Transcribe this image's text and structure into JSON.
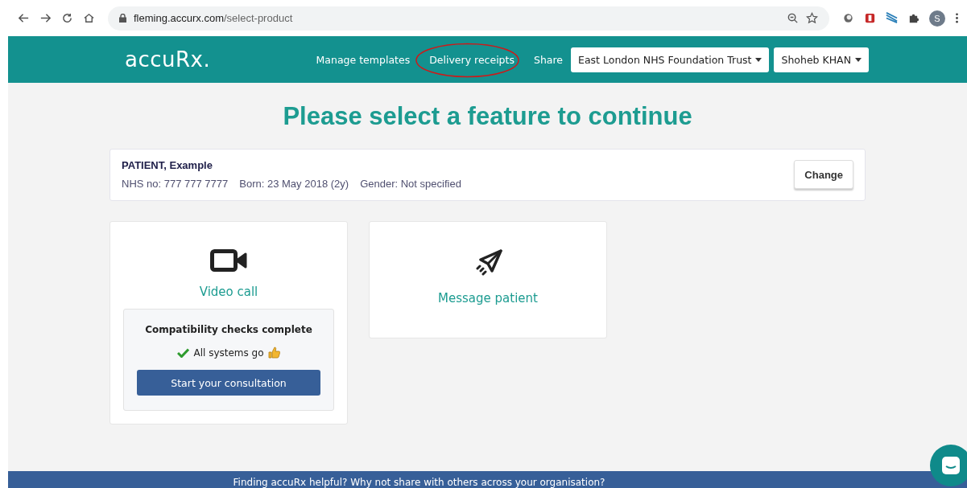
{
  "browser": {
    "url_host": "fleming.accurx.com",
    "url_path": "/select-product",
    "profile_initial": "S"
  },
  "header": {
    "logo": "accuRx.",
    "nav": [
      {
        "label": "Manage templates",
        "circled": false
      },
      {
        "label": "Delivery receipts",
        "circled": true
      },
      {
        "label": "Share",
        "circled": false
      }
    ],
    "dropdowns": [
      "East London NHS Foundation Trust",
      "Shoheb KHAN"
    ]
  },
  "heading": "Please select a feature to continue",
  "patient": {
    "name": "PATIENT, Example",
    "details": [
      "NHS no: 777 777 7777",
      "Born: 23 May 2018 (2y)",
      "Gender: Not specified"
    ],
    "change_button": "Change"
  },
  "features": [
    {
      "kind": "video",
      "label": "Video call",
      "checks": {
        "title": "Compatibility checks complete",
        "status": "All systems go",
        "button": "Start your consultation"
      }
    },
    {
      "kind": "message",
      "label": "Message patient"
    }
  ],
  "footer": "Finding accuRx helpful? Why not share with others across your organisation?"
}
